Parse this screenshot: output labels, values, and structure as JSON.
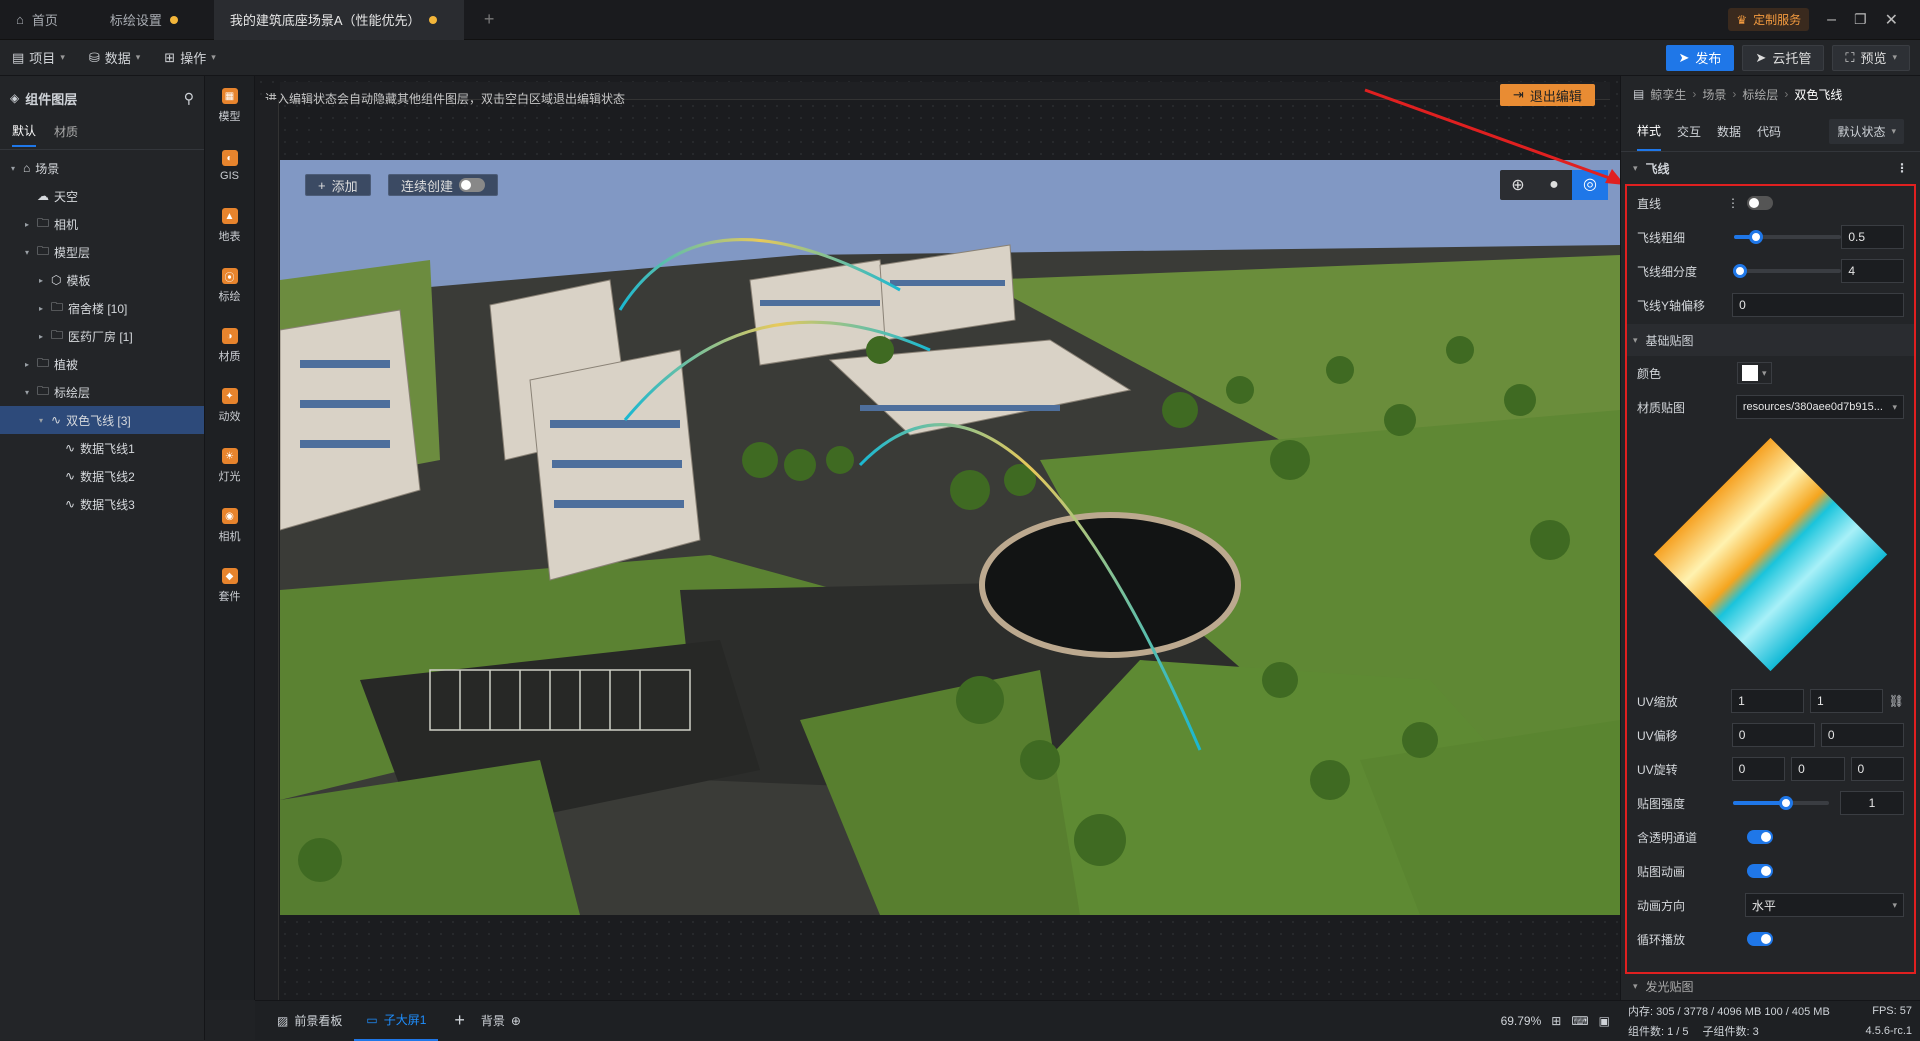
{
  "tabs": [
    {
      "label": "首页",
      "icon": "home-icon"
    },
    {
      "label": "标绘设置",
      "dirty": true
    },
    {
      "label": "我的建筑底座场景A（性能优先）",
      "dirty": true
    }
  ],
  "top_right": {
    "service": "定制服务"
  },
  "menu": {
    "project": "项目",
    "data": "数据",
    "ops": "操作"
  },
  "actions": {
    "publish": "发布",
    "cloud": "云托管",
    "preview": "预览"
  },
  "layers_panel": {
    "title": "组件图层",
    "tabs": [
      "默认",
      "材质"
    ],
    "tree": [
      {
        "label": "场景",
        "depth": 0,
        "caret": "down",
        "icon": "scene-icon"
      },
      {
        "label": "天空",
        "depth": 1,
        "caret": "",
        "icon": "sky-icon"
      },
      {
        "label": "相机",
        "depth": 1,
        "caret": "right",
        "icon": "folder-icon"
      },
      {
        "label": "模型层",
        "depth": 1,
        "caret": "down",
        "icon": "folder-icon"
      },
      {
        "label": "模板",
        "depth": 2,
        "caret": "right",
        "icon": "cube-icon"
      },
      {
        "label": "宿舍楼 [10]",
        "depth": 2,
        "caret": "right",
        "icon": "folder-icon"
      },
      {
        "label": "医药厂房 [1]",
        "depth": 2,
        "caret": "right",
        "icon": "folder-icon"
      },
      {
        "label": "植被",
        "depth": 1,
        "caret": "right",
        "icon": "folder-icon"
      },
      {
        "label": "标绘层",
        "depth": 1,
        "caret": "down",
        "icon": "folder-icon"
      },
      {
        "label": "双色飞线 [3]",
        "depth": 2,
        "caret": "down",
        "icon": "flyline-icon",
        "selected": true
      },
      {
        "label": "数据飞线1",
        "depth": 3,
        "caret": "",
        "icon": "flyline-icon"
      },
      {
        "label": "数据飞线2",
        "depth": 3,
        "caret": "",
        "icon": "flyline-icon"
      },
      {
        "label": "数据飞线3",
        "depth": 3,
        "caret": "",
        "icon": "flyline-icon"
      }
    ]
  },
  "tools": [
    "模型",
    "GIS",
    "地表",
    "标绘",
    "材质",
    "动效",
    "灯光",
    "相机",
    "套件"
  ],
  "canvas": {
    "hint": "进入编辑状态会自动隐藏其他组件图层，双击空白区域退出编辑状态",
    "exit_edit": "退出编辑",
    "add": "添加",
    "continuous": "连续创建"
  },
  "breadcrumb": [
    "鲸孪生",
    "场景",
    "标绘层",
    "双色飞线"
  ],
  "prop_tabs": [
    "样式",
    "交互",
    "数据",
    "代码"
  ],
  "state_select": "默认状态",
  "section_flyline": "飞线",
  "props": {
    "straight": "直线",
    "thickness": {
      "label": "飞线粗细",
      "value": "0.5",
      "pct": 0.2
    },
    "subdiv": {
      "label": "飞线细分度",
      "value": "4",
      "pct": 0.05
    },
    "y_offset": {
      "label": "飞线Y轴偏移",
      "value": "0"
    }
  },
  "section_basic": "基础贴图",
  "basic": {
    "color": "颜色",
    "material": "材质贴图",
    "material_value": "resources/380aee0d7b915...",
    "uv_scale": {
      "label": "UV缩放",
      "values": [
        "1",
        "1"
      ]
    },
    "uv_offset": {
      "label": "UV偏移",
      "values": [
        "0",
        "0"
      ]
    },
    "uv_rotate": {
      "label": "UV旋转",
      "values": [
        "0",
        "0",
        "0"
      ]
    },
    "strength": {
      "label": "贴图强度",
      "value": "1",
      "pct": 0.55
    },
    "alpha": "含透明通道",
    "anim": "贴图动画",
    "direction": {
      "label": "动画方向",
      "value": "水平"
    },
    "loop": "循环播放"
  },
  "section_glow": "发光贴图",
  "bottom": {
    "tab1": "前景看板",
    "tab2": "子大屏1",
    "tab3": "背景",
    "zoom": "69.79%"
  },
  "status": {
    "memory": "内存: 305 / 3778 / 4096 MB  100 / 405 MB",
    "fps": "FPS: 57",
    "components": "组件数: 1 / 5",
    "subcomponents": "子组件数: 3",
    "version": "4.5.6-rc.1"
  }
}
